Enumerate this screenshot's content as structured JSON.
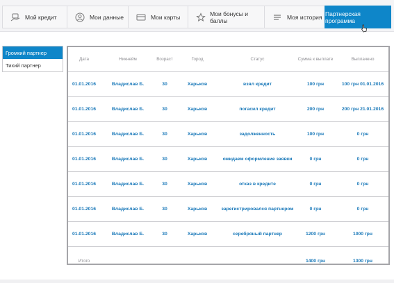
{
  "nav": {
    "tabs": [
      {
        "label": "Мой кредит",
        "icon": "credit-hand-icon",
        "active": false
      },
      {
        "label": "Мои данные",
        "icon": "user-icon",
        "active": false
      },
      {
        "label": "Мои карты",
        "icon": "card-icon",
        "active": false
      },
      {
        "label": "Мои бонусы и баллы",
        "icon": "star-icon",
        "active": false
      },
      {
        "label": "Моя история",
        "icon": "list-icon",
        "active": false
      },
      {
        "label": "Партнерская программа",
        "icon": "",
        "active": true
      }
    ]
  },
  "sidebar": {
    "items": [
      {
        "label": "Громкий партнер",
        "active": true
      },
      {
        "label": "Тихий партнер",
        "active": false
      }
    ]
  },
  "table": {
    "headers": [
      "Дата",
      "Никнейм",
      "Возраст",
      "Город",
      "Статус",
      "Сумма к выплате",
      "Выплачено"
    ],
    "rows": [
      [
        "01.01.2016",
        "Владислав Б.",
        "30",
        "Харьков",
        "взял кредит",
        "100 грн",
        "100 грн 01.01.2016"
      ],
      [
        "01.01.2016",
        "Владислав Б.",
        "30",
        "Харьков",
        "погасил кредит",
        "200 грн",
        "200 грн 21.01.2016"
      ],
      [
        "01.01.2016",
        "Владислав Б.",
        "30",
        "Харьков",
        "задолженность",
        "100 грн",
        "0 грн"
      ],
      [
        "01.01.2016",
        "Владислав Б.",
        "30",
        "Харьков",
        "ожидаем оформление заявки",
        "0 грн",
        "0 грн"
      ],
      [
        "01.01.2016",
        "Владислав Б.",
        "30",
        "Харьков",
        "отказ в кредите",
        "0 грн",
        "0 грн"
      ],
      [
        "01.01.2016",
        "Владислав Б.",
        "30",
        "Харьков",
        "зарегистрировался партнером",
        "0 грн",
        "0 грн"
      ],
      [
        "01.01.2016",
        "Владислав Б.",
        "30",
        "Харьков",
        "серебряный партнер",
        "1200 грн",
        "1000 грн"
      ]
    ],
    "total": {
      "label": "Итого",
      "sum_due": "1400 грн",
      "paid": "1300 грн"
    }
  },
  "colors": {
    "accent": "#0e86c9",
    "link": "#1777b8",
    "header_text": "#8e8e93"
  }
}
